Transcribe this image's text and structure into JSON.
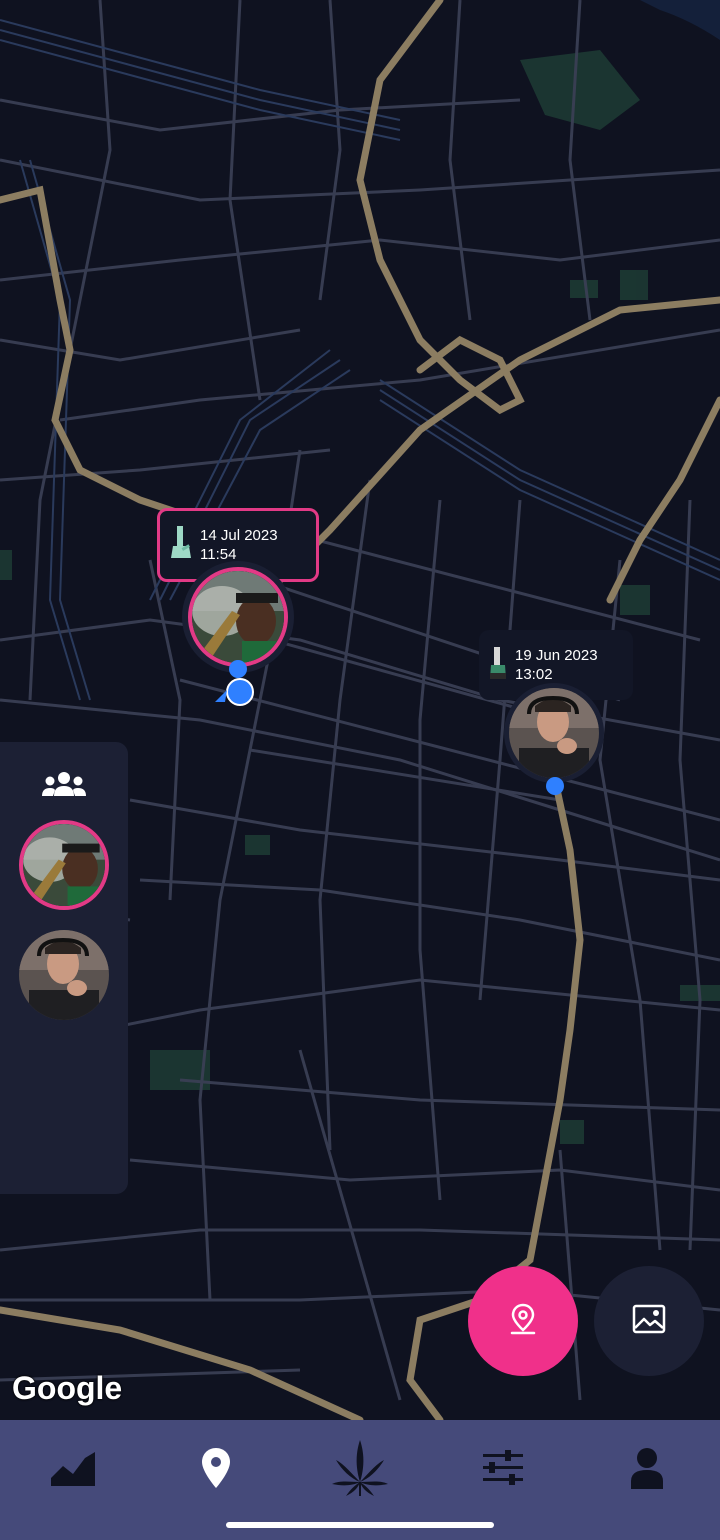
{
  "map": {
    "provider_logo": "Google",
    "markers": [
      {
        "id": "snoop",
        "date": "14 Jul 2023",
        "time": "11:54",
        "icon": "bong-icon",
        "selected": true
      },
      {
        "id": "elon",
        "date": "19 Jun 2023",
        "time": "13:02",
        "icon": "bong-icon",
        "selected": false
      }
    ]
  },
  "friends_panel": {
    "header_icon": "group-icon",
    "friends": [
      {
        "id": "snoop",
        "active": true
      },
      {
        "id": "elon",
        "active": false
      }
    ]
  },
  "fabs": {
    "location": {
      "icon": "map-pin-icon",
      "color": "#f0308a"
    },
    "gallery": {
      "icon": "image-icon",
      "color": "#1c2034"
    }
  },
  "bottom_nav": {
    "items": [
      {
        "icon": "chart-icon",
        "active": false
      },
      {
        "icon": "location-pin-icon",
        "active": true
      },
      {
        "icon": "cannabis-leaf-icon",
        "active": false
      },
      {
        "icon": "sliders-icon",
        "active": false
      },
      {
        "icon": "user-icon",
        "active": false
      }
    ]
  },
  "colors": {
    "accent": "#e23a86",
    "map_background": "#0f1220",
    "nav_background": "#454a7a",
    "panel_background": "#1c2034",
    "location_dot": "#2f80ff"
  }
}
